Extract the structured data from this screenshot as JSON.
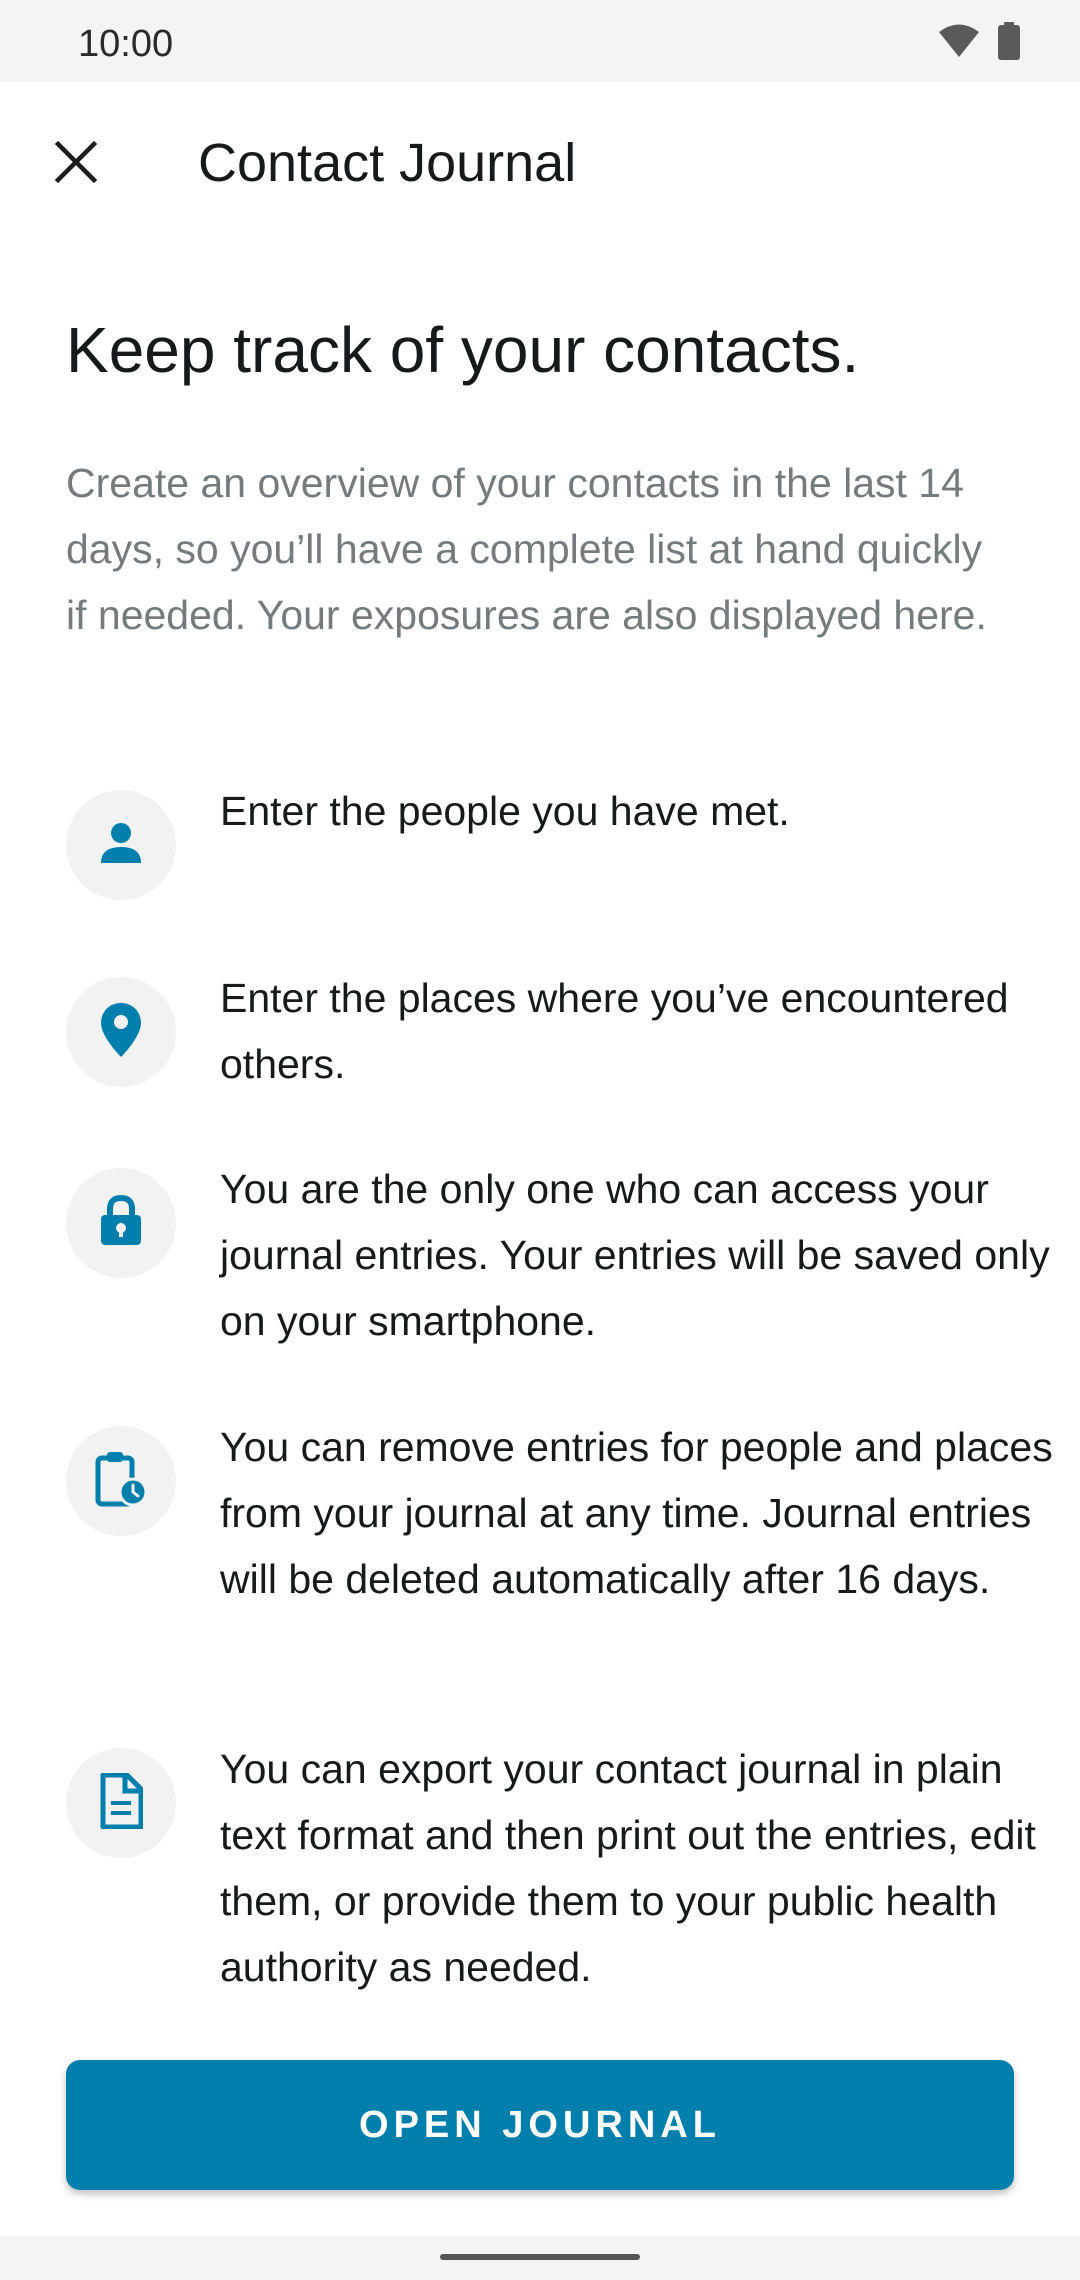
{
  "status_bar": {
    "time": "10:00",
    "icons": [
      "wifi-icon",
      "battery-icon"
    ]
  },
  "toolbar": {
    "close_icon": "close-icon",
    "title": "Contact Journal"
  },
  "main": {
    "headline": "Keep track of your contacts.",
    "intro": "Create an overview of your contacts in the last 14 days, so you’ll have a complete list at hand quickly if needed. Your exposures are also displayed here.",
    "features": [
      {
        "icon": "person-icon",
        "text": "Enter the people you have met."
      },
      {
        "icon": "location-pin-icon",
        "text": "Enter the places where you’ve encountered others."
      },
      {
        "icon": "lock-icon",
        "text": "You are the only one who can access your journal entries. Your entries will be saved only on your smartphone."
      },
      {
        "icon": "clipboard-clock-icon",
        "text": "You can remove entries for people and places from your journal at any time. Journal entries will be deleted automatically after 16 days."
      },
      {
        "icon": "document-icon",
        "text": "You can export your contact journal in plain text format and then print out the entries, edit them, or provide them to your public health authority as needed."
      }
    ]
  },
  "actions": {
    "open_journal_label": "OPEN JOURNAL"
  },
  "colors": {
    "accent": "#007fad",
    "icon_bg": "#f2f2f2",
    "secondary_text": "#757a7d"
  }
}
